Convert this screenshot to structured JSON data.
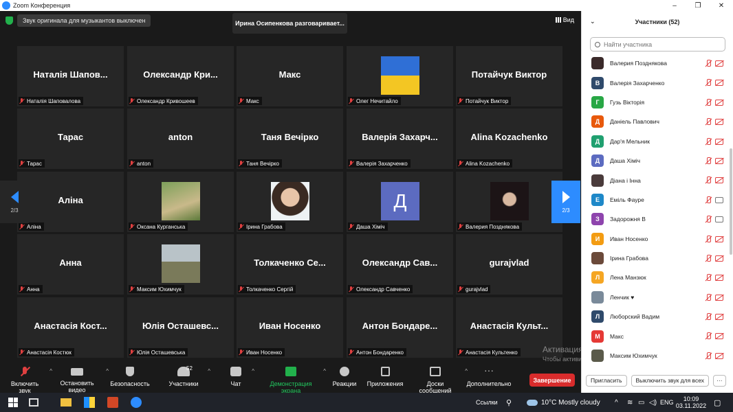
{
  "window": {
    "title": "Zoom Конференция",
    "controls": [
      "–",
      "❐",
      "✕"
    ]
  },
  "main": {
    "notice": "Звук оригинала для музыкантов выключен",
    "speaking": "Ирина Осипенкова разговаривает...",
    "view_label": "Вид",
    "page_left": "2/3",
    "page_right": "2/3",
    "tiles": [
      {
        "name": "Наталія Шапов...",
        "label": "Наталія Шаповалова",
        "photo": null
      },
      {
        "name": "Олександр Кри...",
        "label": "Олександр Кривошеев",
        "photo": null
      },
      {
        "name": "Макс",
        "label": "Макс",
        "photo": null
      },
      {
        "name": "",
        "label": "Олег Нечитайло",
        "photo": "ukraine"
      },
      {
        "name": "Потайчук Виктор",
        "label": "Потайчук Виктор",
        "photo": null
      },
      {
        "name": "Тарас",
        "label": "Тарас",
        "photo": null
      },
      {
        "name": "anton",
        "label": "anton",
        "photo": null
      },
      {
        "name": "Таня Вечірко",
        "label": "Таня Вечірко",
        "photo": null
      },
      {
        "name": "Валерія Захарч...",
        "label": "Валерія Захарченко",
        "photo": null
      },
      {
        "name": "Alina Kozachenko",
        "label": "Alina Kozachenko",
        "photo": null
      },
      {
        "name": "Аліна",
        "label": "Аліна",
        "photo": null
      },
      {
        "name": "",
        "label": "Оксана Курганська",
        "photo": "outdoor"
      },
      {
        "name": "",
        "label": "Ірина Грабова",
        "photo": "portrait"
      },
      {
        "name": "",
        "label": "Даша Хіміч",
        "photo": "letter",
        "letter": "Д"
      },
      {
        "name": "",
        "label": "Валерия Позднякова",
        "photo": "dark"
      },
      {
        "name": "Анна",
        "label": "Анна",
        "photo": null
      },
      {
        "name": "",
        "label": "Максим Юхимчук",
        "photo": "field"
      },
      {
        "name": "Толкаченко Се...",
        "label": "Толкаченко Сергій",
        "photo": null
      },
      {
        "name": "Олександр Сав...",
        "label": "Олександр Савченко",
        "photo": null
      },
      {
        "name": "gurajvlad",
        "label": "gurajvlad",
        "photo": null
      },
      {
        "name": "Анастасія Кост...",
        "label": "Анастасія Костюк",
        "photo": null
      },
      {
        "name": "Юлія Осташевс...",
        "label": "Юлія Осташевська",
        "photo": null
      },
      {
        "name": "Иван Носенко",
        "label": "Иван Носенко",
        "photo": null
      },
      {
        "name": "Антон Бондаре...",
        "label": "Антон Бондаренко",
        "photo": null
      },
      {
        "name": "Анастасія Культ...",
        "label": "Анастасія Культенко",
        "photo": null
      }
    ],
    "activation_title": "Активация Windows",
    "activation_text": "Чтобы активировать Windows, перейдите в раздел \"Параметры\"."
  },
  "toolbar": {
    "mute": "Включить звук",
    "video": "Остановить видео",
    "security": "Безопасность",
    "participants": "Участники",
    "participants_count": "52",
    "chat": "Чат",
    "share": "Демонстрация экрана",
    "reactions": "Реакции",
    "apps": "Приложения",
    "whiteboard": "Доски сообщений",
    "more": "Дополнительно",
    "end": "Завершение",
    "share_color": "#22b14c",
    "end_color": "#d92c2c"
  },
  "panel": {
    "title": "Участники (52)",
    "search_placeholder": "Найти участника",
    "participants": [
      {
        "name": "Валерия Позднякова",
        "initial": "",
        "color": "#3a2a2a",
        "cam": "off"
      },
      {
        "name": "Валерія Захарченко",
        "initial": "В",
        "color": "#2f4a6b",
        "cam": "off"
      },
      {
        "name": "Гузь Вікторія",
        "initial": "Г",
        "color": "#28a745",
        "cam": "off"
      },
      {
        "name": "Даніель Павлович",
        "initial": "Д",
        "color": "#e8590c",
        "cam": "off"
      },
      {
        "name": "Дар'я Мельник",
        "initial": "Д",
        "color": "#20a070",
        "cam": "off"
      },
      {
        "name": "Даша Хіміч",
        "initial": "Д",
        "color": "#5c6bc0",
        "cam": "off"
      },
      {
        "name": "Діана і Інна",
        "initial": "",
        "color": "#4a3b3b",
        "cam": "off"
      },
      {
        "name": "Еміль Фауре",
        "initial": "Е",
        "color": "#1e88c8",
        "cam": "on"
      },
      {
        "name": "Задорожня В",
        "initial": "З",
        "color": "#8e44ad",
        "cam": "on"
      },
      {
        "name": "Иван Носенко",
        "initial": "И",
        "color": "#f39c12",
        "cam": "off"
      },
      {
        "name": "Ірина Грабова",
        "initial": "",
        "color": "#6b4a3a",
        "cam": "off"
      },
      {
        "name": "Лена Манзюк",
        "initial": "Л",
        "color": "#f5a623",
        "cam": "off"
      },
      {
        "name": "Ленчик ♥",
        "initial": "",
        "color": "#7a8a9a",
        "cam": "off"
      },
      {
        "name": "Люборский Вадим",
        "initial": "Л",
        "color": "#2f4a6b",
        "cam": "off"
      },
      {
        "name": "Макс",
        "initial": "М",
        "color": "#e53935",
        "cam": "off"
      },
      {
        "name": "Максим Юхимчук",
        "initial": "",
        "color": "#5a5a4a",
        "cam": "off"
      }
    ],
    "invite": "Пригласить",
    "unmute_all": "Выключить звук для всех",
    "more": "···"
  },
  "taskbar": {
    "links": "Ссылки",
    "weather": "10°C  Mostly cloudy",
    "lang": "ENG",
    "time": "10:09",
    "date": "03.11.2022"
  }
}
